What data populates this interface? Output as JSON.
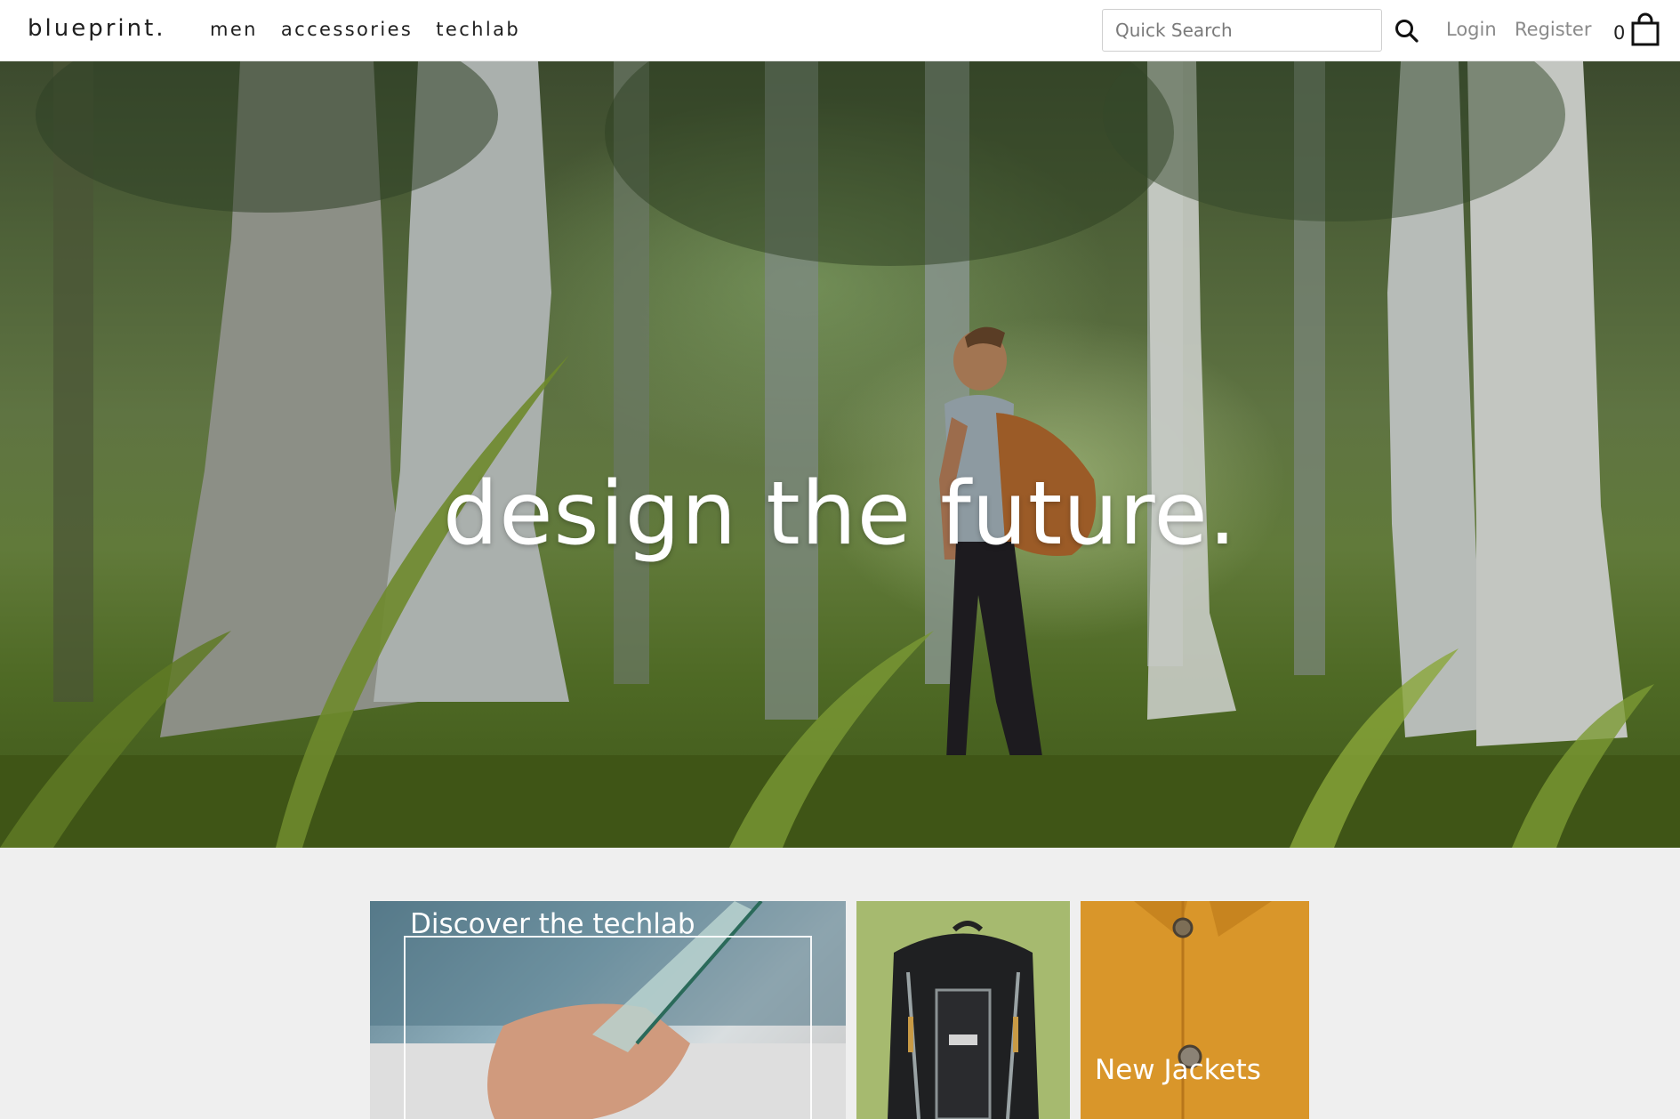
{
  "header": {
    "brand": "blueprint.",
    "nav": [
      "men",
      "accessories",
      "techlab"
    ],
    "search": {
      "placeholder": "Quick Search",
      "value": ""
    },
    "search_icon": "search-icon",
    "login_label": "Login",
    "register_label": "Register",
    "cart_count": "0",
    "cart_icon": "shopping-bag-icon"
  },
  "hero": {
    "title": "design the future."
  },
  "promos": {
    "techlab_title": "Discover the techlab",
    "backpack_image": "backpack",
    "jackets_title": "New Jackets"
  },
  "colors": {
    "hero_text": "#ffffff",
    "backpack_bg": "#a6ba6f",
    "jackets_bg": "#d9962a",
    "page_bg": "#efefef"
  }
}
